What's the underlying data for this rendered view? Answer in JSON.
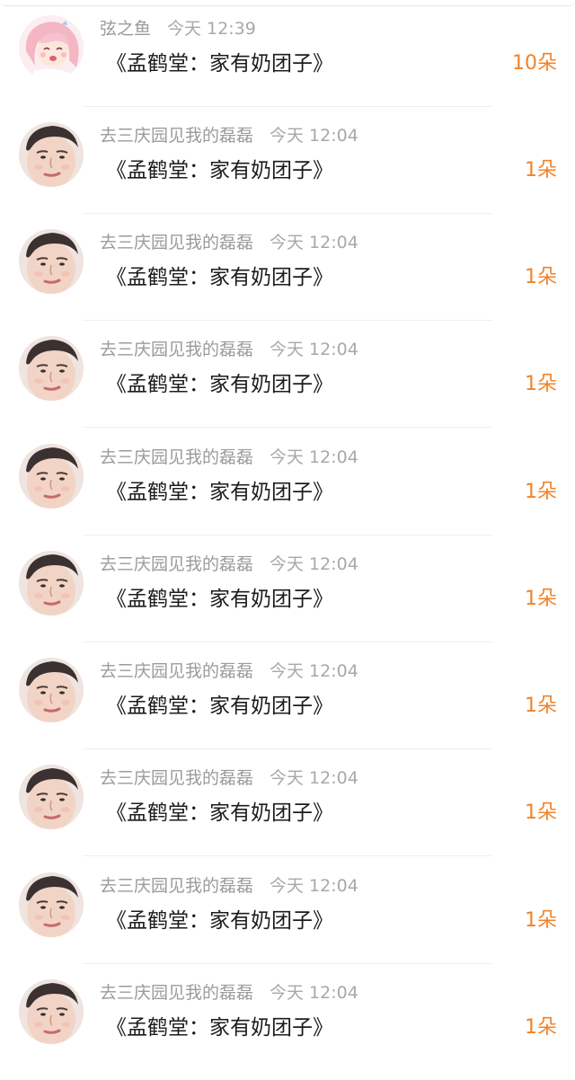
{
  "gift_list": {
    "rows": [
      {
        "avatar": "anime-girl-avatar",
        "name": "弦之鱼",
        "time": "今天 12:39",
        "gift": "《孟鹤堂：家有奶团子》",
        "count": "10朵"
      },
      {
        "avatar": "man-portrait-avatar",
        "name": "去三庆园见我的磊磊",
        "time": "今天 12:04",
        "gift": "《孟鹤堂：家有奶团子》",
        "count": "1朵"
      },
      {
        "avatar": "man-portrait-avatar",
        "name": "去三庆园见我的磊磊",
        "time": "今天 12:04",
        "gift": "《孟鹤堂：家有奶团子》",
        "count": "1朵"
      },
      {
        "avatar": "man-portrait-avatar",
        "name": "去三庆园见我的磊磊",
        "time": "今天 12:04",
        "gift": "《孟鹤堂：家有奶团子》",
        "count": "1朵"
      },
      {
        "avatar": "man-portrait-avatar",
        "name": "去三庆园见我的磊磊",
        "time": "今天 12:04",
        "gift": "《孟鹤堂：家有奶团子》",
        "count": "1朵"
      },
      {
        "avatar": "man-portrait-avatar",
        "name": "去三庆园见我的磊磊",
        "time": "今天 12:04",
        "gift": "《孟鹤堂：家有奶团子》",
        "count": "1朵"
      },
      {
        "avatar": "man-portrait-avatar",
        "name": "去三庆园见我的磊磊",
        "time": "今天 12:04",
        "gift": "《孟鹤堂：家有奶团子》",
        "count": "1朵"
      },
      {
        "avatar": "man-portrait-avatar",
        "name": "去三庆园见我的磊磊",
        "time": "今天 12:04",
        "gift": "《孟鹤堂：家有奶团子》",
        "count": "1朵"
      },
      {
        "avatar": "man-portrait-avatar",
        "name": "去三庆园见我的磊磊",
        "time": "今天 12:04",
        "gift": "《孟鹤堂：家有奶团子》",
        "count": "1朵"
      },
      {
        "avatar": "man-portrait-avatar",
        "name": "去三庆园见我的磊磊",
        "time": "今天 12:04",
        "gift": "《孟鹤堂：家有奶团子》",
        "count": "1朵"
      }
    ]
  },
  "colors": {
    "count_accent": "#f0832a",
    "meta_text": "#9b9b9b",
    "primary_text": "#1c1c1c"
  }
}
